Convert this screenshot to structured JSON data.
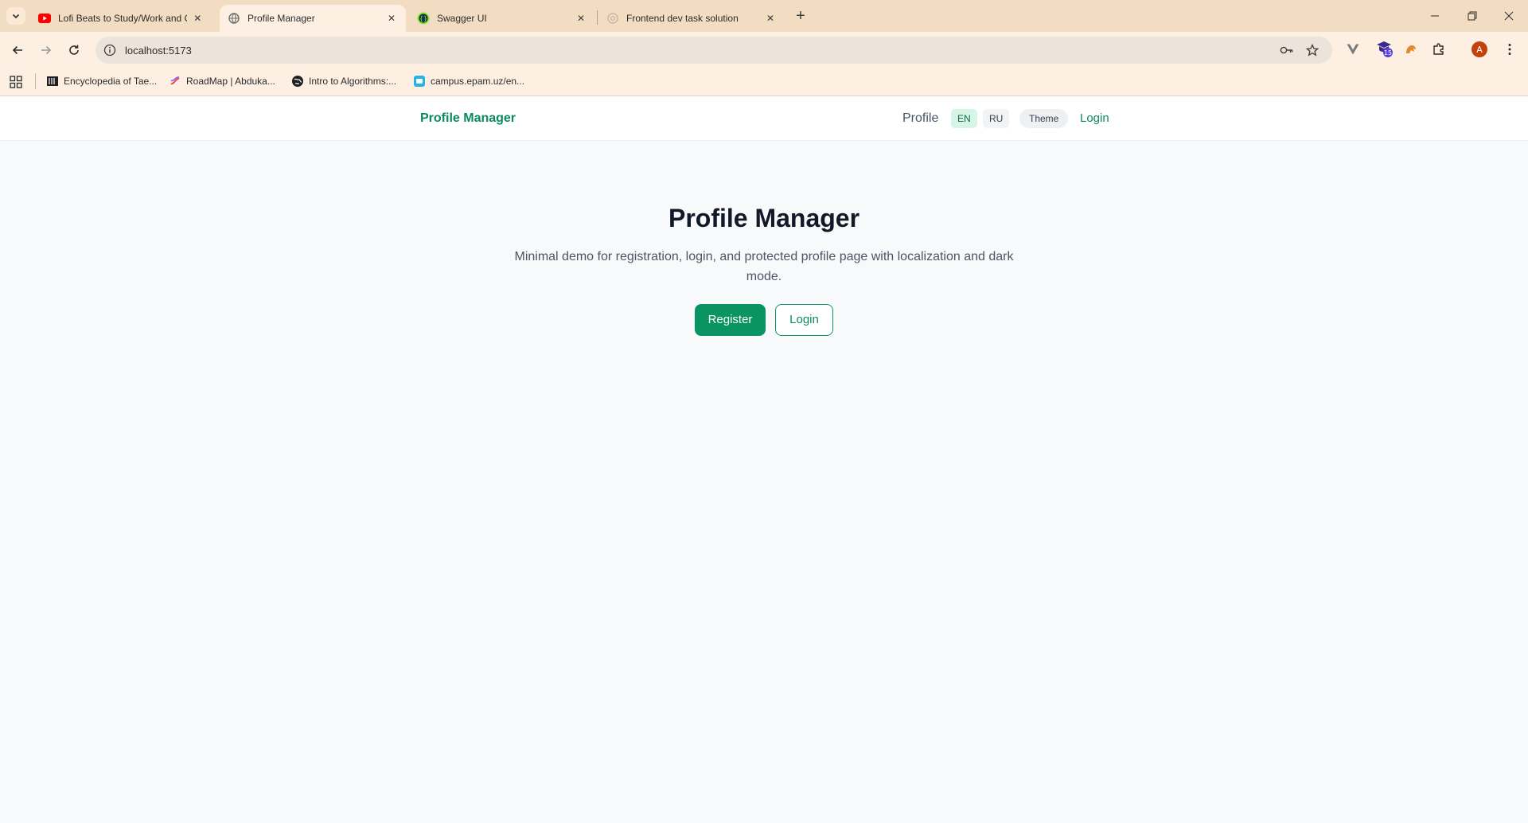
{
  "browser": {
    "tabs": [
      {
        "title": "Lofi Beats to Study/Work and C",
        "favicon": "youtube-icon",
        "active": false
      },
      {
        "title": "Profile Manager",
        "favicon": "globe-icon",
        "active": true
      },
      {
        "title": "Swagger UI",
        "favicon": "swagger-icon",
        "active": false
      },
      {
        "title": "Frontend dev task solution",
        "favicon": "chatgpt-icon",
        "active": false
      }
    ],
    "url": "localhost:5173",
    "bookmarks": [
      {
        "label": "Encyclopedia of Tae...",
        "icon": "book-icon"
      },
      {
        "label": "RoadMap | Abduka...",
        "icon": "roadmap-icon"
      },
      {
        "label": "Intro to Algorithms:...",
        "icon": "globe-dark-icon"
      },
      {
        "label": "campus.epam.uz/en...",
        "icon": "campus-icon"
      }
    ],
    "extension_badge": "15",
    "profile_initial": "A",
    "colors": {
      "tabbar": "#f2dcc2",
      "toolbar": "#fdf0e3",
      "accent": "#0a9463",
      "profile": "#c2410c"
    }
  },
  "app": {
    "brand": "Profile Manager",
    "nav": {
      "profile": "Profile",
      "lang_en": "EN",
      "lang_ru": "RU",
      "theme": "Theme",
      "login": "Login"
    },
    "hero": {
      "title": "Profile Manager",
      "subtitle": "Minimal demo for registration, login, and protected profile page with localization and dark mode.",
      "register_label": "Register",
      "login_label": "Login"
    }
  }
}
